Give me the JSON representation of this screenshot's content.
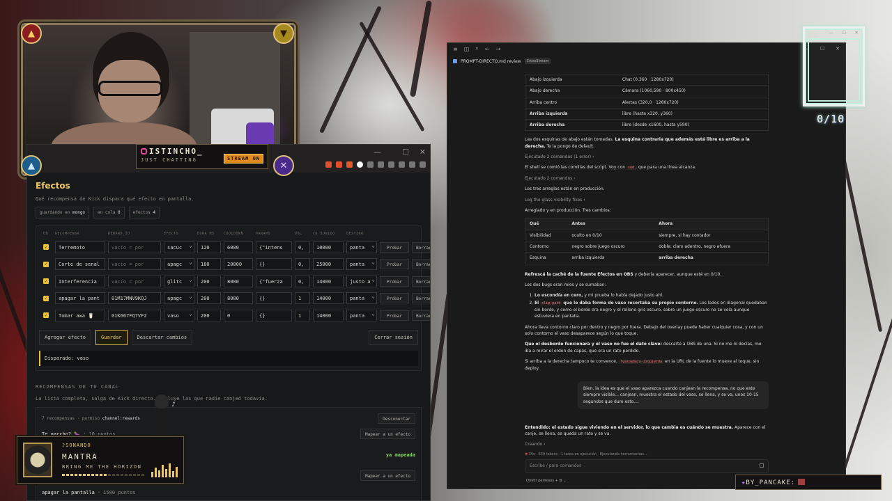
{
  "webcam": {
    "channel_name": "ISTINCHO_",
    "category": "JUST CHATTING",
    "stream_badge": "STREAM ON"
  },
  "efectos": {
    "title": "Efectos",
    "description": "Qué recompensa de Kick dispara qué efecto en pantalla.",
    "pills": [
      {
        "label": "guardando en",
        "value": "mongo"
      },
      {
        "label": "en cola",
        "value": "0"
      },
      {
        "label": "efectos",
        "value": "4"
      }
    ],
    "columns": [
      "ON",
      "RECOMPENSA",
      "REWARD_ID",
      "EFECTO",
      "DURA MS",
      "COOLDOWN",
      "PARAMS",
      "VOL",
      "CD SONIDO",
      "DESTINO",
      "",
      ""
    ],
    "rows": [
      {
        "recompensa": "Terremoto",
        "reward_id": "vacío = por",
        "efecto": "sacuc",
        "dura": "120",
        "cooldown": "6000",
        "params": "{\"intens",
        "vol": "0,",
        "cd_sonido": "10000",
        "destino": "panta"
      },
      {
        "recompensa": "Corte de senal",
        "reward_id": "vacío = por",
        "efecto": "apagc",
        "dura": "180",
        "cooldown": "20000",
        "params": "{}",
        "vol": "0,",
        "cd_sonido": "25000",
        "destino": "panta"
      },
      {
        "recompensa": "Interferencia",
        "reward_id": "vacío = por",
        "efecto": "glitc",
        "dura": "200",
        "cooldown": "8000",
        "params": "{\"fuerza",
        "vol": "0,",
        "cd_sonido": "14000",
        "destino": "justo a"
      },
      {
        "recompensa": "apagar la pant",
        "reward_id": "01M17MNV9KQJ",
        "efecto": "apagc",
        "dura": "200",
        "cooldown": "8000",
        "params": "{}",
        "vol": "1",
        "cd_sonido": "14000",
        "destino": "panta"
      },
      {
        "recompensa": "Tomar awa 🥛",
        "reward_id": "01K667FQ7VF2",
        "efecto": "vaso",
        "dura": "200",
        "cooldown": "0",
        "params": "{}",
        "vol": "1",
        "cd_sonido": "14000",
        "destino": "panta"
      }
    ],
    "probar_label": "Probar",
    "borrar_label": "Borrar",
    "buttons": {
      "add": "Agregar efecto",
      "save": "Guardar",
      "discard": "Descartar cambios",
      "logout": "Cerrar sesión"
    },
    "log": "Disparado: vaso"
  },
  "recompensas": {
    "title": "RECOMPENSAS DE TU CANAL",
    "description": "La lista completa, salga de Kick directo. Incluye las que nadie canjeó todavía.",
    "count_text": "7 recompensas · permiso",
    "permission": "channel:rewards",
    "disconnect": "Desconectar",
    "items": [
      {
        "name": "Te garcho? 🍆",
        "points": "· 10 puntos",
        "action": "Mapear a un efecto"
      },
      {
        "name": "",
        "points": "",
        "action": "ya mapeada"
      },
      {
        "name": "",
        "points": "",
        "action": "Mapear a un efecto"
      },
      {
        "name": "apagar la pantalla",
        "points": "· 1500 puntos",
        "action": ""
      }
    ]
  },
  "now_playing": {
    "label": "♪SONANDO",
    "song": "MANTRA",
    "artist": "BRING ME THE HORIZON",
    "progress": 0.55
  },
  "doc": {
    "tab_title": "PROMPT-DIRECTO.md review",
    "tab_tag": "CrossStream",
    "table1": [
      {
        "pos": "Abajo izquierda",
        "val": "Chat (0,360 · 1280x720)",
        "bold": false
      },
      {
        "pos": "Abajo derecha",
        "val": "Cámara (1060,590 · 800x450)",
        "bold": false
      },
      {
        "pos": "Arriba centro",
        "val": "Alertas (320,0 · 1280x720)",
        "bold": false
      },
      {
        "pos": "Arriba izquierda",
        "val": "libre (hasta x320, y360)",
        "bold": true
      },
      {
        "pos": "Arriba derecha",
        "val": "libre (desde x1600, hasta y590)",
        "bold": true
      }
    ],
    "p1_a": "Las dos esquinas de abajo están tomadas. ",
    "p1_b": "La esquina contraria que además está libre es arriba a la derecha.",
    "p1_c": " Te la pongo de default.",
    "ran1": "Ejecutado 2 comandos (1 error) ›",
    "p2_a": "El shell se comió las comillas del script. Voy con ",
    "p2_code": "sed",
    "p2_b": ", que para una línea alcanza.",
    "ran2": "Ejecutado 2 comandos ›",
    "p3": "Los tres arreglos están en producción.",
    "log_fix": "Log the glass visibility fixes ›",
    "p4": "Arreglado y en producción. Tres cambios:",
    "table2_head": [
      "Qué",
      "Antes",
      "Ahora"
    ],
    "table2": [
      {
        "que": "Visibilidad",
        "antes": "oculto en 0/10",
        "ahora": "siempre, si hay contador"
      },
      {
        "que": "Contorno",
        "antes": "negro sobre juego oscuro",
        "ahora": "doble: claro adentro, negro afuera"
      },
      {
        "que": "Esquina",
        "antes": "arriba izquierda",
        "ahora": "arriba derecha"
      }
    ],
    "p5_a": "Refrescá la caché de la fuente Efectos en OBS",
    "p5_b": " y debería aparecer, aunque esté en 0/10.",
    "p6": "Los dos bugs eran míos y se sumaban:",
    "li1_a": "Lo escondía en cero,",
    "li1_b": " y mi prueba lo había dejado justo ahí.",
    "li2_a": "El ",
    "li2_code": "clip-path",
    "li2_b": " que le daba forma de vaso recortaba su propio contorno.",
    "li2_c": " Los lados en diagonal quedaban sin borde, y como el borde era negro y el relleno gris oscuro, sobre un juego oscuro no se veía aunque estuviera en pantalla.",
    "p7": "Ahora lleva contorno claro por dentro y negro por fuera. Debajo del overlay puede haber cualquier cosa, y con un solo contorno el vaso desaparece según lo que toque.",
    "p8_a": "Que el desborde funcionara y el vaso no fue el dato clave:",
    "p8_b": " descarté a OBS de una. Si no me lo decías, me iba a mirar el orden de capas, que era un rato perdido.",
    "p9_a": "Si arriba a la derecha tampoco te convence, ",
    "p9_code": "?vasoabajo-izquierda",
    "p9_b": " en la URL de la fuente lo mueve al toque, sin deploy.",
    "bubble": "Bien, la idea es que el vaso aparezca cuando canjean la recompensa, no que este siempre visible... canjean, muestra el estado del vaso, se llena, y se va, unos 10-15 segundos que dure esto....",
    "p10_a": "Entendido: el estado sigue viviendo en el servidor, lo que cambia es ",
    "p10_b": "cuándo se muestra.",
    "p10_c": " Aparece con el canje, se llena, se queda un rato y se va.",
    "creating": "Creando ›",
    "status": "35s · 639 tokens · 1 tarea en ejecución · Ejecutando herramientas...",
    "input_placeholder": "Escribe / para comandos",
    "footer": "Omitir permisos  +  ⚙  ⌄"
  },
  "overlay": {
    "counter": "0/10",
    "signature": "BY_PANCAKE:"
  }
}
